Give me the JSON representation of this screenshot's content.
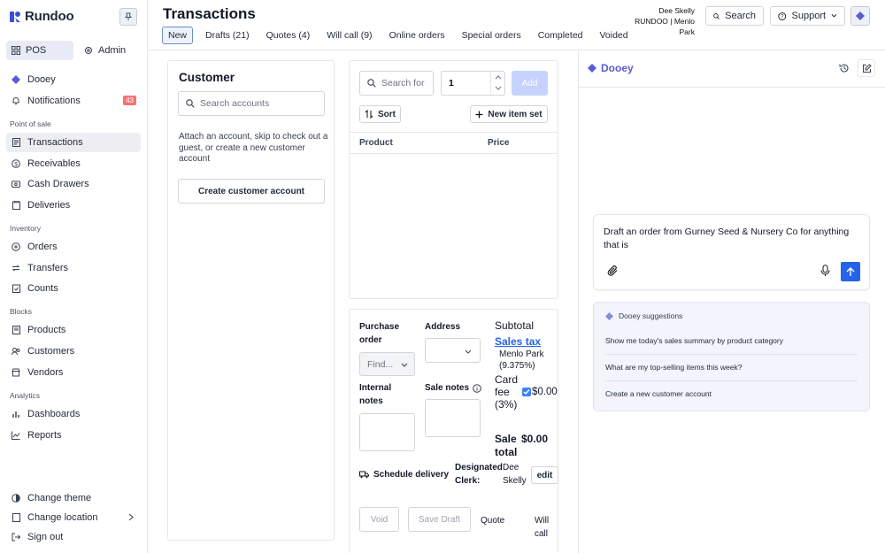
{
  "app": {
    "name": "Rundoo"
  },
  "sidebar": {
    "modes": [
      {
        "label": "POS"
      },
      {
        "label": "Admin"
      }
    ],
    "top_items": [
      {
        "label": "Dooey"
      },
      {
        "label": "Notifications",
        "badge": "43"
      }
    ],
    "sections": {
      "pos": "Point of sale",
      "inventory": "Inventory",
      "blocks": "Blocks",
      "analytics": "Analytics"
    },
    "pos_items": [
      {
        "label": "Transactions"
      },
      {
        "label": "Receivables"
      },
      {
        "label": "Cash Drawers"
      },
      {
        "label": "Deliveries"
      }
    ],
    "inventory_items": [
      {
        "label": "Orders"
      },
      {
        "label": "Transfers"
      },
      {
        "label": "Counts"
      }
    ],
    "block_items": [
      {
        "label": "Products"
      },
      {
        "label": "Customers"
      },
      {
        "label": "Vendors"
      }
    ],
    "analytics_items": [
      {
        "label": "Dashboards"
      },
      {
        "label": "Reports"
      }
    ],
    "bottom_items": [
      {
        "label": "Change theme"
      },
      {
        "label": "Change location"
      },
      {
        "label": "Sign out"
      }
    ]
  },
  "header": {
    "title": "Transactions",
    "tabs": [
      {
        "label": "New"
      },
      {
        "label": "Drafts (21)"
      },
      {
        "label": "Quotes (4)"
      },
      {
        "label": "Will call (9)"
      },
      {
        "label": "Online orders"
      },
      {
        "label": "Special orders"
      },
      {
        "label": "Completed"
      },
      {
        "label": "Voided"
      }
    ],
    "user_name": "Dee Skelly",
    "user_location": "RUNDOO | Menlo Park",
    "search_label": "Search",
    "support_label": "Support"
  },
  "customer": {
    "title": "Customer",
    "search_placeholder": "Search accounts",
    "description": "Attach an account, skip to check out a guest, or create a new customer account",
    "create_button": "Create customer account"
  },
  "products": {
    "search_placeholder": "Search for",
    "quantity": "1",
    "add_label": "Add",
    "sort_label": "Sort",
    "new_item_set_label": "New item set",
    "col_product": "Product",
    "col_price": "Price"
  },
  "order": {
    "purchase_order_label": "Purchase order",
    "find_placeholder": "Find...",
    "address_label": "Address",
    "internal_notes_label": "Internal notes",
    "sale_notes_label": "Sale notes",
    "subtotal_label": "Subtotal",
    "sales_tax_label": "Sales tax",
    "tax_location": "Menlo Park (9.375%)",
    "card_fee_label": "Card fee (3%)",
    "card_fee_value": "$0.00",
    "card_fee_checked": true,
    "sale_total_label": "Sale total",
    "sale_total_value": "$0.00",
    "schedule_delivery_label": "Schedule delivery",
    "designated_clerk_label": "Designated Clerk:",
    "clerk_name": "Dee Skelly",
    "edit_label": "edit",
    "void_label": "Void",
    "save_draft_label": "Save Draft",
    "quote_label": "Quote",
    "will_call_label": "Will call"
  },
  "dooey": {
    "title": "Dooey",
    "chat_text": "Draft an order from Gurney Seed & Nursery Co for anything that is",
    "suggestions_title": "Dooey suggestions",
    "suggestions": [
      {
        "label": "Show me today's sales summary by product category"
      },
      {
        "label": "What are my top-selling items this week?"
      },
      {
        "label": "Create a new customer account"
      }
    ]
  },
  "colors": {
    "accent": "#5b5bd6",
    "badge": "#f87171",
    "send": "#2563eb",
    "add_disabled": "#c7d2fe"
  }
}
